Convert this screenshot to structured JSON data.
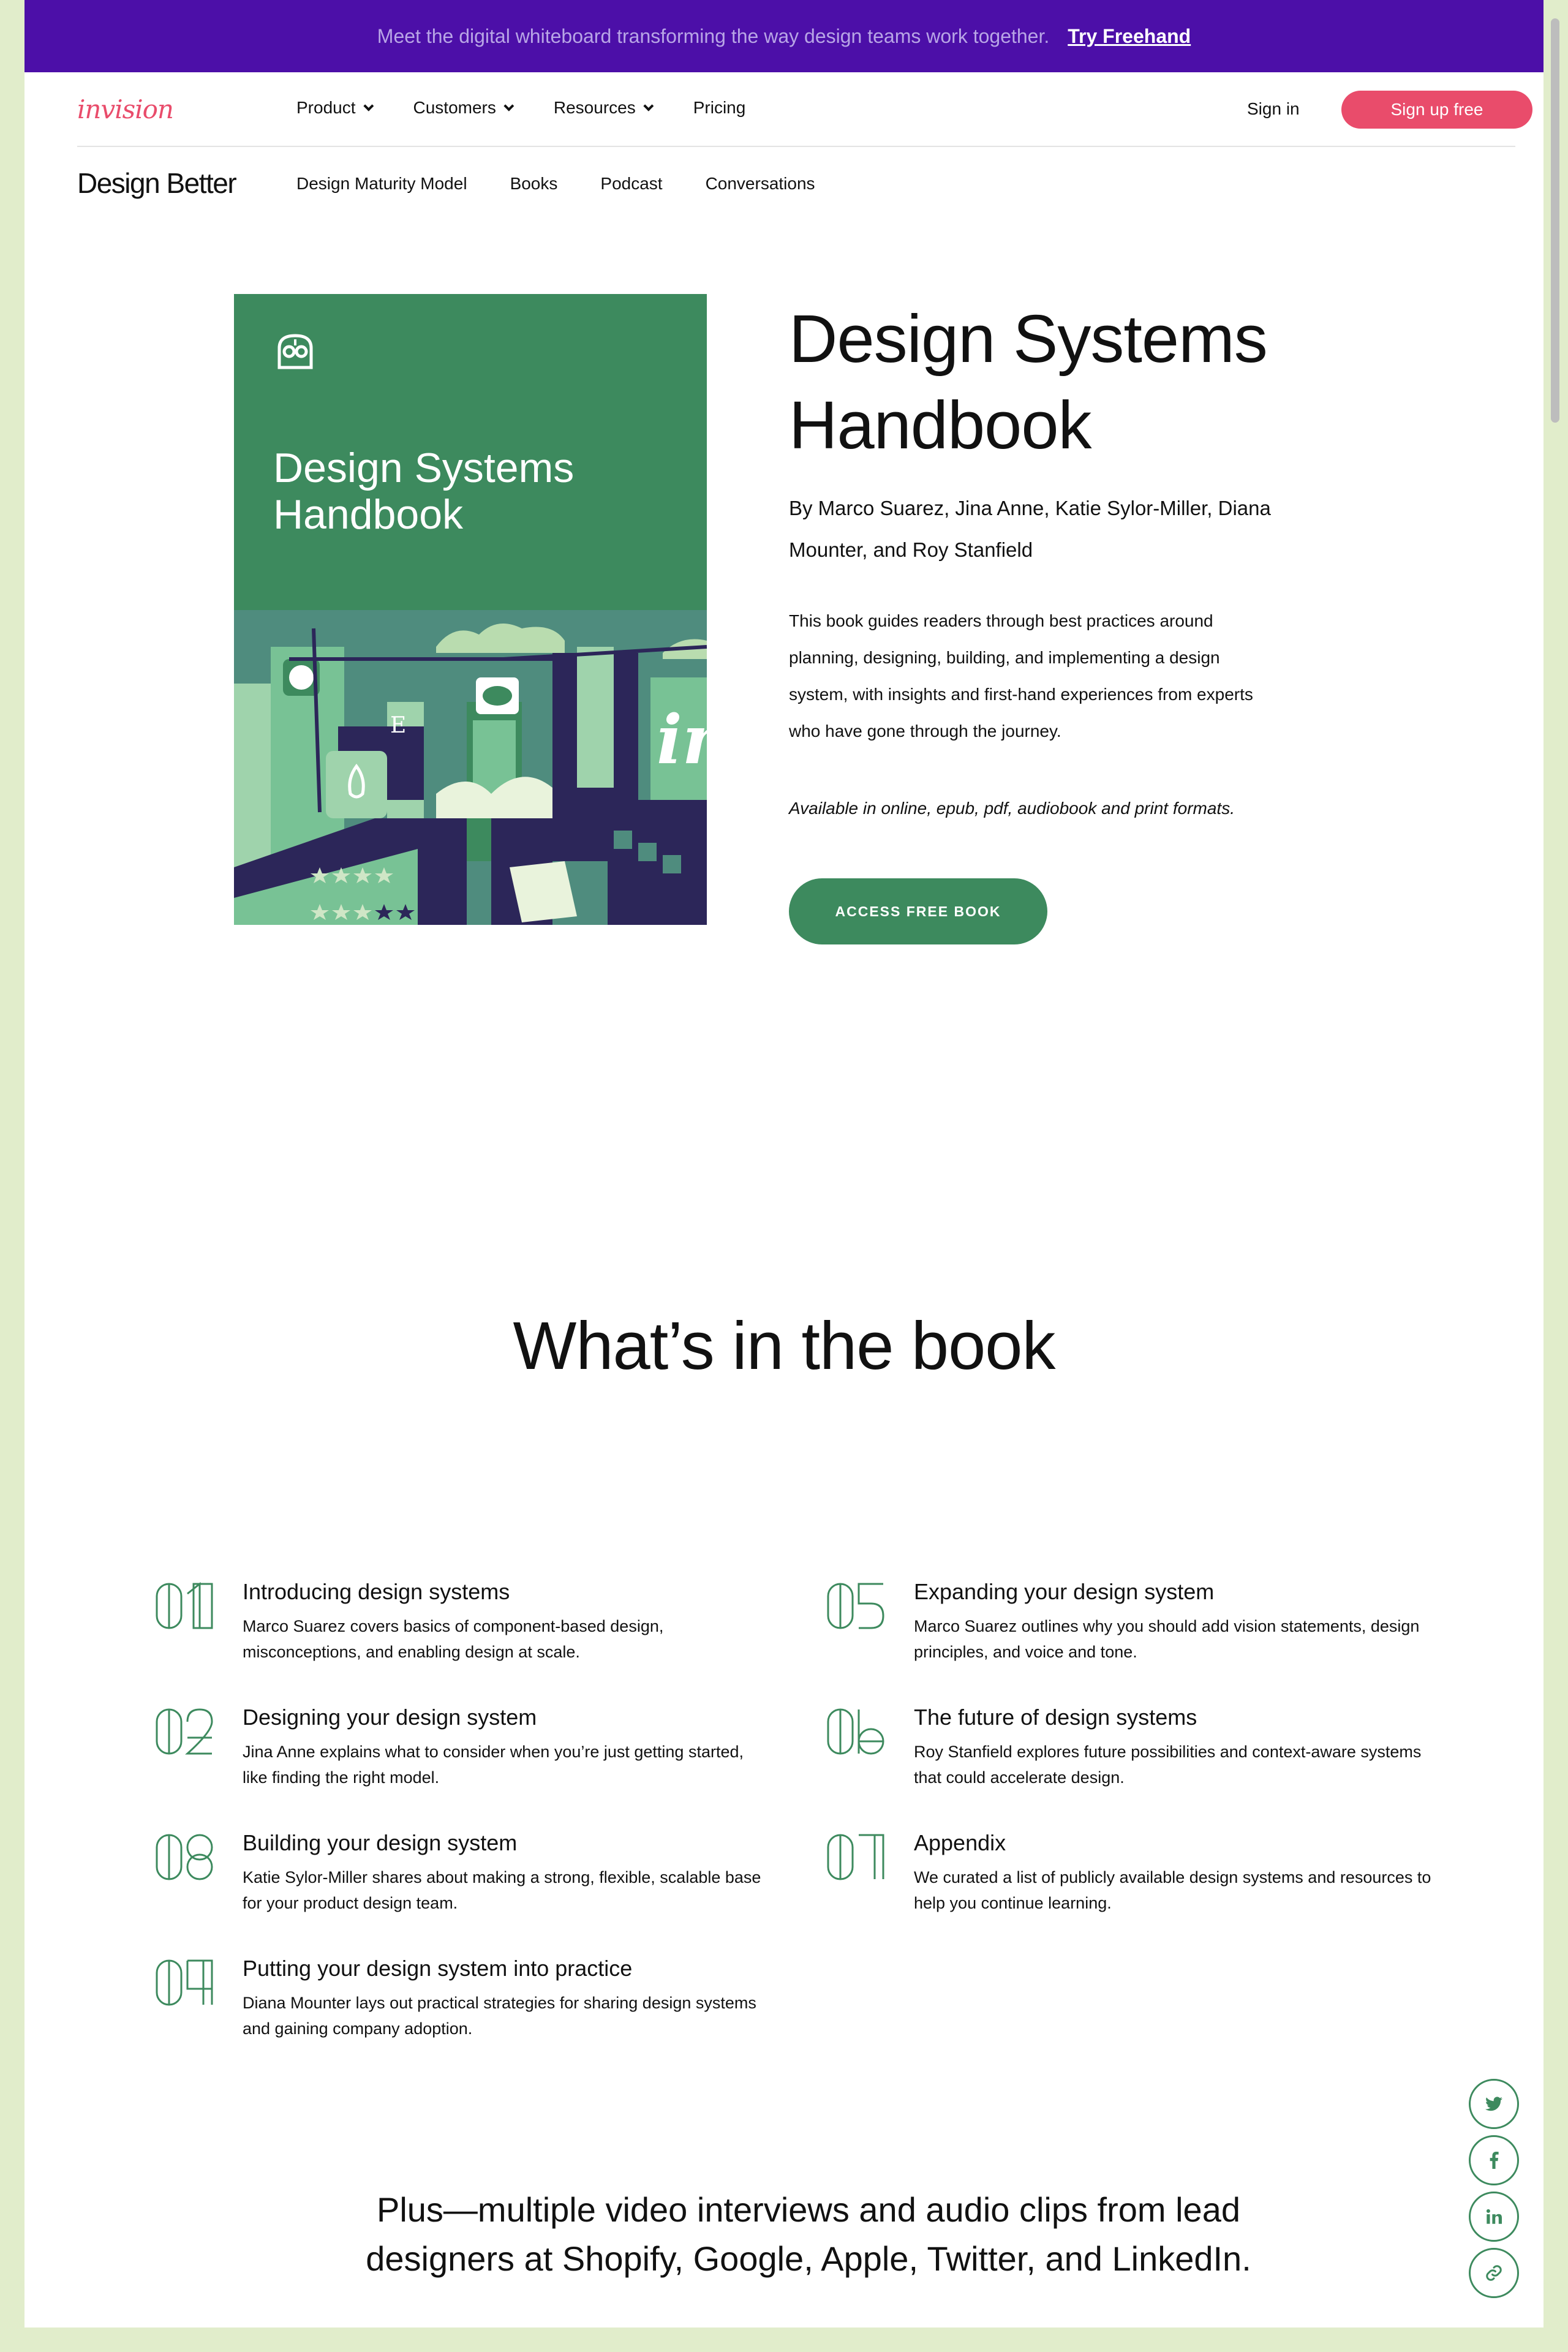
{
  "banner": {
    "message": "Meet the digital whiteboard transforming the way design teams work together.",
    "cta": "Try Freehand"
  },
  "topnav": {
    "logo": "invision",
    "items": [
      {
        "label": "Product",
        "has_dropdown": true
      },
      {
        "label": "Customers",
        "has_dropdown": true
      },
      {
        "label": "Resources",
        "has_dropdown": true
      },
      {
        "label": "Pricing",
        "has_dropdown": false
      }
    ],
    "signin": "Sign in",
    "signup": "Sign up free"
  },
  "subnav": {
    "brand": "Design Better",
    "items": [
      "Design Maturity Model",
      "Books",
      "Podcast",
      "Conversations"
    ]
  },
  "hero": {
    "cover_title": "Design Systems Handbook",
    "title": "Design Systems Handbook",
    "authors": "By Marco Suarez, Jina Anne, Katie Sylor-Miller, Diana Mounter, and Roy Stanfield",
    "description": "This book guides readers through best practices around planning, designing, building, and implementing a design system, with insights and first-hand experiences from experts who have gone through the journey.",
    "formats": "Available in online, epub, pdf, audiobook and print formats.",
    "cta": "ACCESS FREE BOOK"
  },
  "contents": {
    "title": "What’s in the book",
    "chapters": [
      {
        "num": "01",
        "title": "Introducing design systems",
        "desc": "Marco Suarez covers basics of component-based design, misconceptions, and enabling design at scale."
      },
      {
        "num": "02",
        "title": "Designing your design system",
        "desc": "Jina Anne explains what to consider when you’re just getting started, like finding the right model."
      },
      {
        "num": "03",
        "title": "Building your design system",
        "desc": "Katie Sylor-Miller shares about making a strong, flexible, scalable base for your product design team."
      },
      {
        "num": "04",
        "title": "Putting your design system into practice",
        "desc": "Diana Mounter lays out practical strategies for sharing design systems and gaining company adoption."
      },
      {
        "num": "05",
        "title": "Expanding your design system",
        "desc": "Marco Suarez outlines why you should add vision statements, design principles, and voice and tone."
      },
      {
        "num": "06",
        "title": "The future of design systems",
        "desc": "Roy Stanfield explores future possibilities and context-aware systems that could accelerate design."
      },
      {
        "num": "07",
        "title": "Appendix",
        "desc": "We curated a list of publicly available design systems and resources to help you continue learning."
      }
    ]
  },
  "plus": "Plus—multiple video interviews and audio clips from lead designers at Shopify, Google, Apple, Twitter, and LinkedIn.",
  "social": [
    "twitter-icon",
    "facebook-icon",
    "linkedin-icon",
    "link-icon"
  ],
  "colors": {
    "banner": "#4c0fa8",
    "brand_pink": "#e94c6b",
    "accent_green": "#3d8a5e",
    "page_bg": "#e1edcb"
  }
}
